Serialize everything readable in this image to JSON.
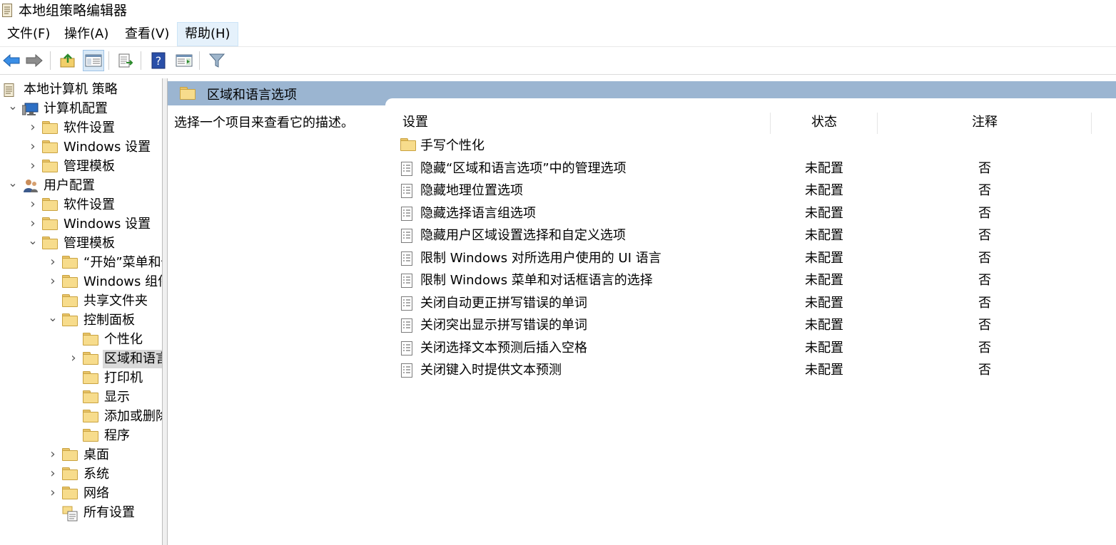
{
  "window": {
    "title": "本地组策略编辑器",
    "icon": "policy-document-icon"
  },
  "menu": [
    "文件(F)",
    "操作(A)",
    "查看(V)",
    "帮助(H)"
  ],
  "toolbar": {
    "buttons": [
      "back-arrow-icon",
      "forward-arrow-icon",
      "up-folder-icon",
      "show-hide-tree-icon",
      "export-list-icon",
      "help-icon",
      "show-hide-action-pane-icon",
      "filter-icon"
    ]
  },
  "tree": [
    {
      "label": "本地计算机 策略",
      "level": 0,
      "expander": "",
      "icon": "policy-document-icon"
    },
    {
      "label": "计算机配置",
      "level": 1,
      "expander": "expanded",
      "icon": "computer-icon"
    },
    {
      "label": "软件设置",
      "level": 2,
      "expander": "collapsed",
      "icon": "folder-icon"
    },
    {
      "label": "Windows 设置",
      "level": 2,
      "expander": "collapsed",
      "icon": "folder-icon"
    },
    {
      "label": "管理模板",
      "level": 2,
      "expander": "collapsed",
      "icon": "folder-icon"
    },
    {
      "label": "用户配置",
      "level": 1,
      "expander": "expanded",
      "icon": "users-icon"
    },
    {
      "label": "软件设置",
      "level": 2,
      "expander": "collapsed",
      "icon": "folder-icon"
    },
    {
      "label": "Windows 设置",
      "level": 2,
      "expander": "collapsed",
      "icon": "folder-icon"
    },
    {
      "label": "管理模板",
      "level": 2,
      "expander": "expanded",
      "icon": "folder-icon"
    },
    {
      "label": "“开始”菜单和任务栏",
      "level": 3,
      "expander": "collapsed",
      "icon": "folder-icon"
    },
    {
      "label": "Windows 组件",
      "level": 3,
      "expander": "collapsed",
      "icon": "folder-icon"
    },
    {
      "label": "共享文件夹",
      "level": 3,
      "expander": "",
      "icon": "folder-icon"
    },
    {
      "label": "控制面板",
      "level": 3,
      "expander": "expanded",
      "icon": "folder-icon"
    },
    {
      "label": "个性化",
      "level": 4,
      "expander": "",
      "icon": "folder-icon"
    },
    {
      "label": "区域和语言选项",
      "level": 4,
      "expander": "collapsed",
      "icon": "folder-icon",
      "selected": true
    },
    {
      "label": "打印机",
      "level": 4,
      "expander": "",
      "icon": "folder-icon"
    },
    {
      "label": "显示",
      "level": 4,
      "expander": "",
      "icon": "folder-icon"
    },
    {
      "label": "添加或删除程序",
      "level": 4,
      "expander": "",
      "icon": "folder-icon"
    },
    {
      "label": "程序",
      "level": 4,
      "expander": "",
      "icon": "folder-icon"
    },
    {
      "label": "桌面",
      "level": 3,
      "expander": "collapsed",
      "icon": "folder-icon"
    },
    {
      "label": "系统",
      "level": 3,
      "expander": "collapsed",
      "icon": "folder-icon"
    },
    {
      "label": "网络",
      "level": 3,
      "expander": "collapsed",
      "icon": "folder-icon"
    },
    {
      "label": "所有设置",
      "level": 3,
      "expander": "",
      "icon": "all-settings-icon"
    }
  ],
  "right": {
    "header_title": "区域和语言选项",
    "description": "选择一个项目来查看它的描述。",
    "columns": {
      "setting": "设置",
      "state": "状态",
      "comment": "注释"
    },
    "rows": [
      {
        "type": "folder",
        "name": "手写个性化",
        "state": "",
        "comment": ""
      },
      {
        "type": "setting",
        "name": "隐藏“区域和语言选项”中的管理选项",
        "state": "未配置",
        "comment": "否"
      },
      {
        "type": "setting",
        "name": "隐藏地理位置选项",
        "state": "未配置",
        "comment": "否"
      },
      {
        "type": "setting",
        "name": "隐藏选择语言组选项",
        "state": "未配置",
        "comment": "否"
      },
      {
        "type": "setting",
        "name": "隐藏用户区域设置选择和自定义选项",
        "state": "未配置",
        "comment": "否"
      },
      {
        "type": "setting",
        "name": "限制 Windows 对所选用户使用的 UI 语言",
        "state": "未配置",
        "comment": "否"
      },
      {
        "type": "setting",
        "name": "限制 Windows 菜单和对话框语言的选择",
        "state": "未配置",
        "comment": "否"
      },
      {
        "type": "setting",
        "name": "关闭自动更正拼写错误的单词",
        "state": "未配置",
        "comment": "否"
      },
      {
        "type": "setting",
        "name": "关闭突出显示拼写错误的单词",
        "state": "未配置",
        "comment": "否"
      },
      {
        "type": "setting",
        "name": "关闭选择文本预测后插入空格",
        "state": "未配置",
        "comment": "否"
      },
      {
        "type": "setting",
        "name": "关闭键入时提供文本预测",
        "state": "未配置",
        "comment": "否"
      }
    ]
  }
}
